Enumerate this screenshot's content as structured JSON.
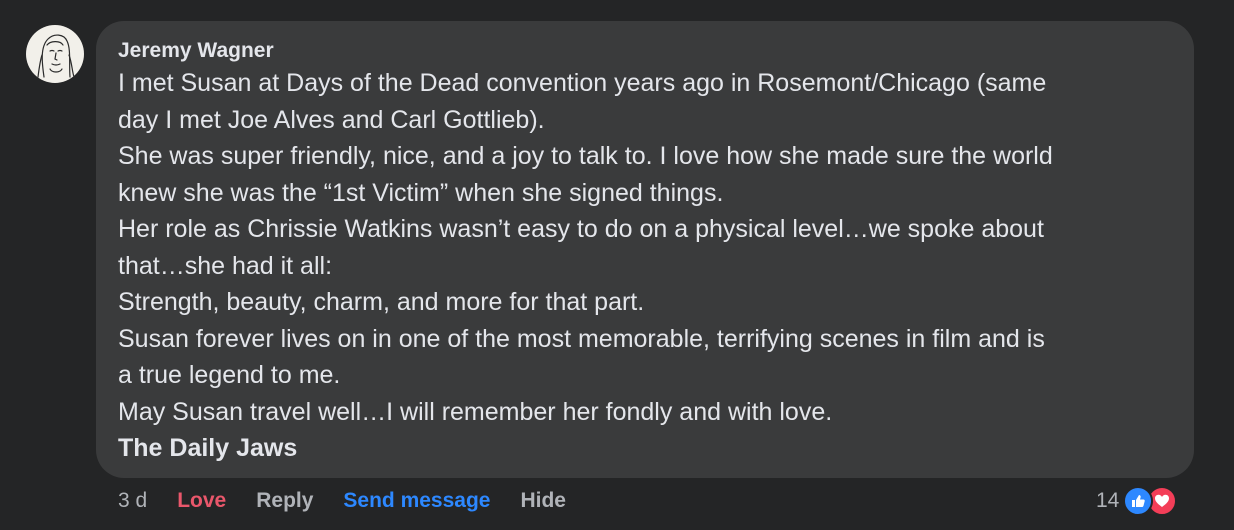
{
  "comment": {
    "author": "Jeremy Wagner",
    "lines": [
      "I met Susan at Days of the Dead convention years ago in Rosemont/Chicago (same",
      "day I met Joe Alves and Carl Gottlieb).",
      "She was super friendly, nice, and a joy to talk to. I love how she made sure the world",
      "knew she was the “1st Victim” when she signed things.",
      "Her role as Chrissie Watkins wasn’t easy to do on a physical level…we spoke about",
      "that…she had it all:",
      "Strength, beauty, charm, and more for that part.",
      "Susan forever lives on in one of the most memorable, terrifying scenes in film and is",
      "a true legend to me.",
      "May Susan travel well…I will remember her fondly and with love."
    ],
    "tagged_page": "The Daily Jaws"
  },
  "actions": {
    "time": "3 d",
    "love": "Love",
    "reply": "Reply",
    "send_message": "Send message",
    "hide": "Hide"
  },
  "reactions": {
    "count": "14",
    "icons": [
      "like-icon",
      "heart-icon"
    ]
  },
  "colors": {
    "background": "#242526",
    "bubble": "#3a3b3c",
    "love": "#e9576b",
    "link": "#2d88ff",
    "like": "#2d88ff",
    "heart": "#f33e58"
  }
}
